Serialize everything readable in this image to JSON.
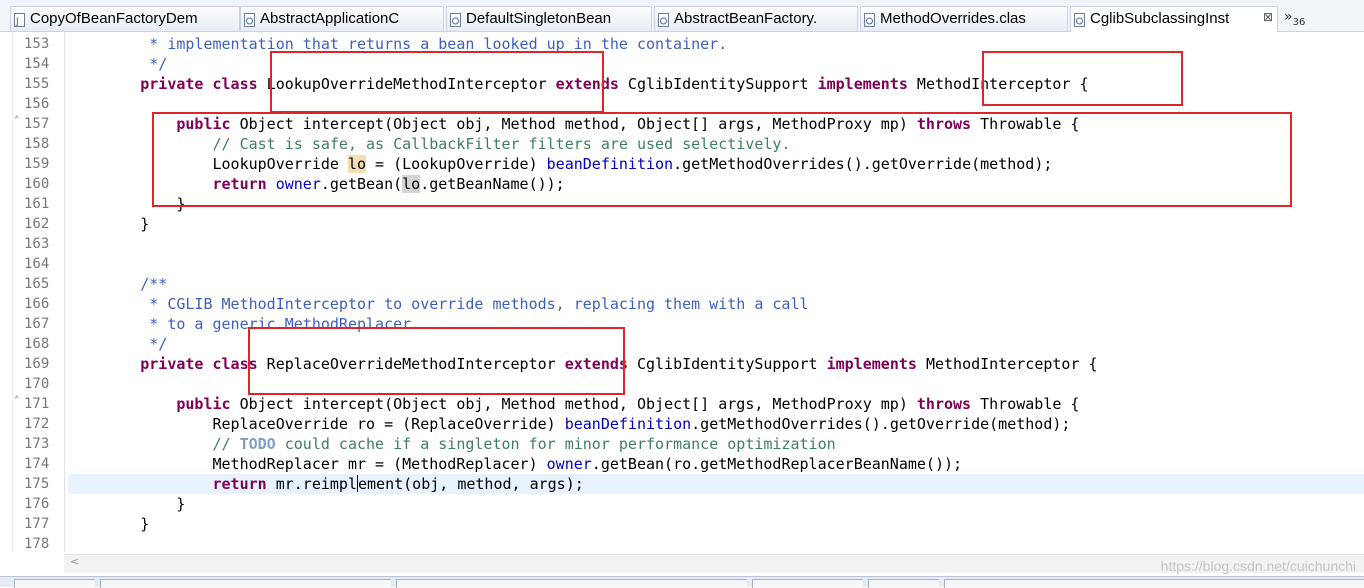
{
  "tabs": [
    {
      "label": "CopyOfBeanFactoryDem",
      "active": false
    },
    {
      "label": "AbstractApplicationC",
      "active": false
    },
    {
      "label": "DefaultSingletonBean",
      "active": false
    },
    {
      "label": "AbstractBeanFactory.",
      "active": false
    },
    {
      "label": "MethodOverrides.clas",
      "active": false
    },
    {
      "label": "CglibSubclassingInst",
      "active": true,
      "close": "⊠"
    }
  ],
  "overflow": {
    "chevron": "»",
    "count": "36"
  },
  "lines": [
    {
      "n": "153",
      "tokens": [
        [
          "cm",
          "         * implementation that returns a bean looked up in the container."
        ]
      ]
    },
    {
      "n": "154",
      "tokens": [
        [
          "cm",
          "         */"
        ]
      ]
    },
    {
      "n": "155",
      "tokens": [
        [
          "t",
          "        "
        ],
        [
          "kw",
          "private"
        ],
        [
          "t",
          " "
        ],
        [
          "kw",
          "class"
        ],
        [
          "t",
          " LookupOverrideMethodInterceptor "
        ],
        [
          "kw",
          "extends"
        ],
        [
          "t",
          " CglibIdentitySupport "
        ],
        [
          "kw",
          "implements"
        ],
        [
          "t",
          " MethodInterceptor {"
        ]
      ]
    },
    {
      "n": "156",
      "tokens": []
    },
    {
      "n": "157",
      "fold": true,
      "tokens": [
        [
          "t",
          "            "
        ],
        [
          "kw",
          "public"
        ],
        [
          "t",
          " Object intercept(Object obj, Method method, Object[] args, MethodProxy mp) "
        ],
        [
          "kw",
          "throws"
        ],
        [
          "t",
          " Throwable {"
        ]
      ]
    },
    {
      "n": "158",
      "tokens": [
        [
          "lc",
          "                // Cast is safe, as CallbackFilter filters are used selectively."
        ]
      ]
    },
    {
      "n": "159",
      "tokens": [
        [
          "t",
          "                LookupOverride "
        ],
        [
          "occw",
          "lo"
        ],
        [
          "t",
          " = (LookupOverride) "
        ],
        [
          "fld",
          "beanDefinition"
        ],
        [
          "t",
          ".getMethodOverrides().getOverride(method);"
        ]
      ]
    },
    {
      "n": "160",
      "tokens": [
        [
          "t",
          "                "
        ],
        [
          "kw",
          "return"
        ],
        [
          "t",
          " "
        ],
        [
          "fld",
          "owner"
        ],
        [
          "t",
          ".getBean("
        ],
        [
          "occ",
          "lo"
        ],
        [
          "t",
          ".getBeanName());"
        ]
      ]
    },
    {
      "n": "161",
      "tokens": [
        [
          "t",
          "            }"
        ]
      ]
    },
    {
      "n": "162",
      "tokens": [
        [
          "t",
          "        }"
        ]
      ]
    },
    {
      "n": "163",
      "tokens": []
    },
    {
      "n": "164",
      "tokens": []
    },
    {
      "n": "165",
      "tokens": [
        [
          "cm",
          "        /**"
        ]
      ]
    },
    {
      "n": "166",
      "tokens": [
        [
          "cm",
          "         * CGLIB MethodInterceptor to override methods, replacing them with a call"
        ]
      ]
    },
    {
      "n": "167",
      "tokens": [
        [
          "cm",
          "         * to a generic MethodReplacer."
        ]
      ]
    },
    {
      "n": "168",
      "tokens": [
        [
          "cm",
          "         */"
        ]
      ]
    },
    {
      "n": "169",
      "tokens": [
        [
          "t",
          "        "
        ],
        [
          "kw",
          "private"
        ],
        [
          "t",
          " "
        ],
        [
          "kw",
          "class"
        ],
        [
          "t",
          " ReplaceOverrideMethodInterceptor "
        ],
        [
          "kw",
          "extends"
        ],
        [
          "t",
          " CglibIdentitySupport "
        ],
        [
          "kw",
          "implements"
        ],
        [
          "t",
          " MethodInterceptor {"
        ]
      ]
    },
    {
      "n": "170",
      "tokens": []
    },
    {
      "n": "171",
      "fold": true,
      "tokens": [
        [
          "t",
          "            "
        ],
        [
          "kw",
          "public"
        ],
        [
          "t",
          " Object intercept(Object obj, Method method, Object[] args, MethodProxy mp) "
        ],
        [
          "kw",
          "throws"
        ],
        [
          "t",
          " Throwable {"
        ]
      ]
    },
    {
      "n": "172",
      "tokens": [
        [
          "t",
          "                ReplaceOverride ro = (ReplaceOverride) "
        ],
        [
          "fld",
          "beanDefinition"
        ],
        [
          "t",
          ".getMethodOverrides().getOverride(method);"
        ]
      ]
    },
    {
      "n": "173",
      "tokens": [
        [
          "lc",
          "                // "
        ],
        [
          "todo",
          "TODO"
        ],
        [
          "lc",
          " could cache if a singleton for minor performance optimization"
        ]
      ]
    },
    {
      "n": "174",
      "tokens": [
        [
          "t",
          "                MethodReplacer mr = (MethodReplacer) "
        ],
        [
          "fld",
          "owner"
        ],
        [
          "t",
          ".getBean(ro.getMethodReplacerBeanName());"
        ]
      ]
    },
    {
      "n": "175",
      "current": true,
      "tokens": [
        [
          "t",
          "                "
        ],
        [
          "kw",
          "return"
        ],
        [
          "t",
          " mr.reimpl"
        ],
        [
          "caret",
          ""
        ],
        [
          "t",
          "ement(obj, method, args);"
        ]
      ]
    },
    {
      "n": "176",
      "tokens": [
        [
          "t",
          "            }"
        ]
      ]
    },
    {
      "n": "177",
      "tokens": [
        [
          "t",
          "        }"
        ]
      ]
    },
    {
      "n": "178",
      "tokens": []
    }
  ],
  "scroll_arrow": "<",
  "watermark": "https://blog.csdn.net/cuichunchi",
  "colors": {
    "keyword": "#7f0055",
    "javadoc": "#3f5fbf",
    "line_comment": "#3f7f5f",
    "field": "#0000c0",
    "annotation_box": "#e0242b"
  }
}
